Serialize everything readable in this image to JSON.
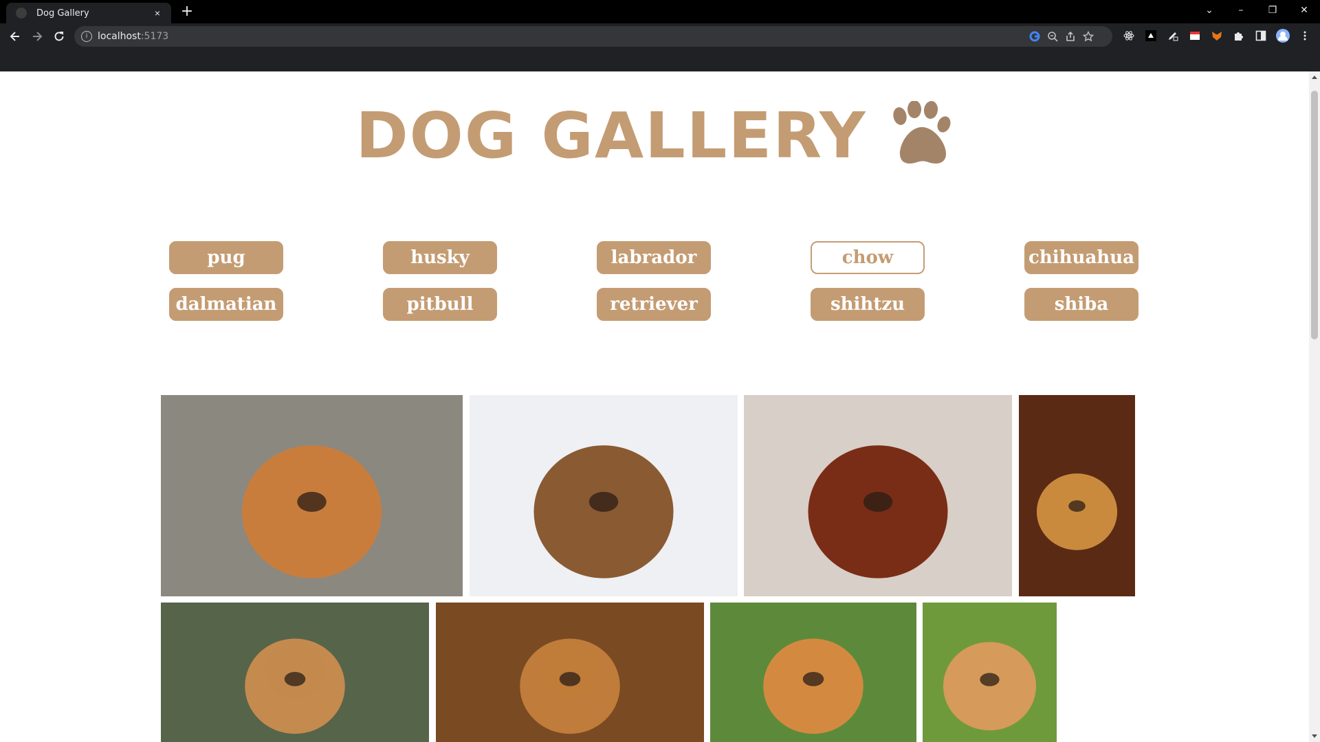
{
  "browser": {
    "tab_title": "Dog Gallery",
    "tab_close": "×",
    "new_tab": "+",
    "url_host": "localhost",
    "url_port": ":5173",
    "window_controls": {
      "tab_search": "⌄",
      "minimize": "–",
      "restore": "❐",
      "close": "✕"
    }
  },
  "page": {
    "title": "DOG GALLERY",
    "icon": "paw-icon",
    "accent_color": "#c49c73",
    "selected_breed": "chow",
    "breeds": [
      "pug",
      "husky",
      "labrador",
      "chow",
      "chihuahua",
      "dalmatian",
      "pitbull",
      "retriever",
      "shihtzu",
      "shiba"
    ],
    "photos": [
      {
        "subject": "chow-dog-lying-on-pavement",
        "palette": [
          "#8b8880",
          "#c97d3c"
        ]
      },
      {
        "subject": "chow-puppy-in-snow",
        "palette": [
          "#eef0f4",
          "#8a5a32"
        ]
      },
      {
        "subject": "red-chow-on-tile-floor",
        "palette": [
          "#d8cfc8",
          "#7a2d16"
        ]
      },
      {
        "subject": "chow-sitting-on-wood-floor",
        "palette": [
          "#5b2a14",
          "#c98a3e"
        ]
      },
      {
        "subject": "chow-puppy-on-green-blanket",
        "palette": [
          "#56644a",
          "#c48a4e"
        ]
      },
      {
        "subject": "chow-face-closeup",
        "palette": [
          "#7a4a22",
          "#c07c3a"
        ]
      },
      {
        "subject": "chow-on-grass",
        "palette": [
          "#5c8a3a",
          "#d38a40"
        ]
      },
      {
        "subject": "chow-puppy-outdoors",
        "palette": [
          "#6f9a3c",
          "#d69a5a"
        ]
      }
    ]
  }
}
